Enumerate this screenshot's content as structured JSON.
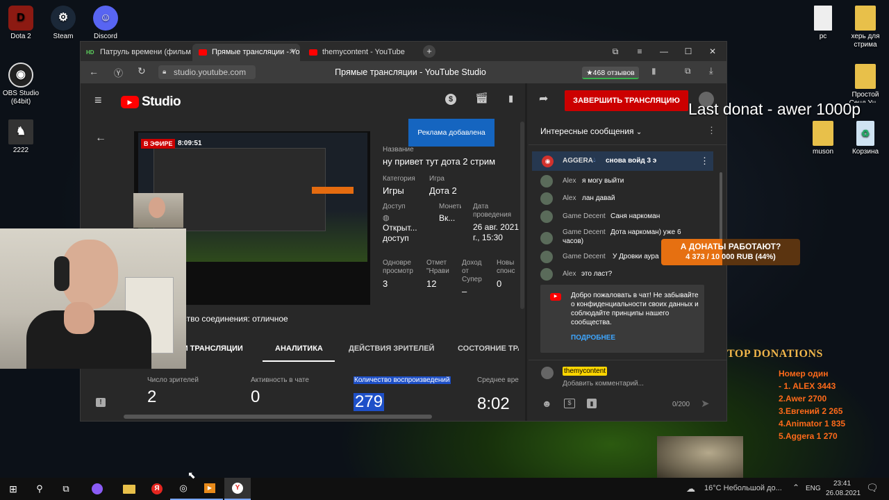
{
  "desktop": {
    "left_icons": [
      {
        "label": "Dota 2"
      },
      {
        "label": "Steam"
      },
      {
        "label": "Discord"
      },
      {
        "label": "OBS Studio (64bit)"
      },
      {
        "label": "2222"
      }
    ],
    "right_icons": [
      {
        "label": "рс"
      },
      {
        "label": "херь для стрима"
      },
      {
        "label": "Простой Сенд Уч..."
      },
      {
        "label": "muson"
      },
      {
        "label": "Корзина"
      }
    ]
  },
  "overlay": {
    "last_donat": "Last donat - awer 1000р",
    "goal_title": "А ДОНАТЫ РАБОТАЮТ?",
    "goal_progress": "4 373 / 10 000 RUB (44%)",
    "goal_fraction": 0.44,
    "top_title": "TOP DONATIONS",
    "top_subtitle": "Номер один",
    "top_list": [
      "- 1. ALEX 3443",
      "2.Awer 2700",
      "3.Евгений 2 265",
      "4.Animator 1 835",
      "5.Aggera 1 270"
    ]
  },
  "browser": {
    "tabs": [
      {
        "label": "Патруль времени (фильм"
      },
      {
        "label": "Прямые трансляции - Yo"
      },
      {
        "label": "themycontent - YouTube"
      }
    ],
    "url": "studio.youtube.com",
    "page_title": "Прямые трансляции - YouTube Studio",
    "reviews": "★468 отзывов"
  },
  "studio": {
    "logo": "Studio",
    "end_stream": "ЗАВЕРШИТЬ ТРАНСЛЯЦИЮ",
    "tooltip": "Реклама добавлена",
    "live_badge": "В ЭФИРЕ",
    "live_time": "8:09:51",
    "title_label": "Название",
    "title_value": "ну привет тут дота 2 стрим",
    "category_label": "Категория",
    "category_value": "Игры",
    "game_label": "Игра",
    "game_value": "Дота 2",
    "access_label": "Доступ",
    "access_value": "Открыт... доступ",
    "monet_label": "Монети",
    "monet_value": "Вк...",
    "date_label": "Дата проведения",
    "date_value": "26 авг. 2021 г., 15:30",
    "concurrent_label": "Одновре просмотр",
    "concurrent_value": "3",
    "likes_label": "Отмет \"Нрави",
    "likes_value": "12",
    "income_label": "Доход от Супер",
    "income_value": "–",
    "new_label": "Новы спонс",
    "new_value": "0",
    "connection": "ество соединения: отличное",
    "tabs": [
      "КИ ТРАНСЛЯЦИИ",
      "АНАЛИТИКА",
      "ДЕЙСТВИЯ ЗРИТЕЛЕЙ",
      "СОСТОЯНИЕ ТРА"
    ],
    "stats": [
      {
        "label": "Число зрителей",
        "value": "2"
      },
      {
        "label": "Активность в чате",
        "value": "0"
      },
      {
        "label": "Количество воспроизведений",
        "value": "279"
      },
      {
        "label": "Среднее врем",
        "value": "8:02"
      }
    ]
  },
  "chat": {
    "header": "Интересные сообщения",
    "pinned_name": "AGGERA",
    "pinned_msg": "снова войд 3 э",
    "messages": [
      {
        "name": "Alex",
        "msg": "я могу выйти"
      },
      {
        "name": "Alex",
        "msg": "лан давай"
      },
      {
        "name": "Game Decent",
        "msg": "Саня наркоман"
      },
      {
        "name": "Game Decent",
        "msg": "Дота наркоман) уже 6 часов)"
      },
      {
        "name": "Game Decent",
        "msg": "У Дровки аура"
      },
      {
        "name": "Alex",
        "msg": "это ласт?"
      }
    ],
    "welcome": "Добро пожаловать в чат! Не забывайте о конфиденциальности своих данных и соблюдайте принципы нашего сообщества.",
    "more": "ПОДРОБНЕЕ",
    "user": "themycontent",
    "placeholder": "Добавить комментарий...",
    "counter": "0/200"
  },
  "taskbar": {
    "weather": "16°C Небольшой до...",
    "lang": "ENG",
    "time": "23:41",
    "date": "26.08.2021"
  }
}
